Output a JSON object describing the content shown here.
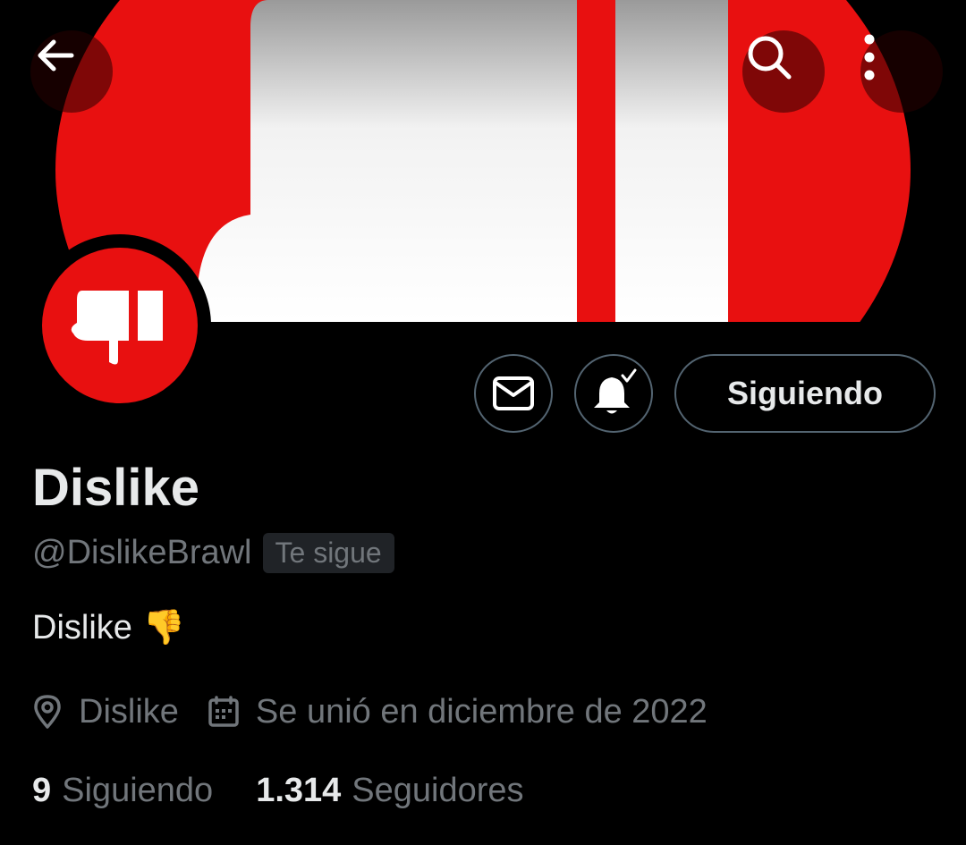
{
  "profile": {
    "name": "Dislike",
    "handle": "@DislikeBrawl",
    "follows_you_badge": "Te sigue",
    "bio_text": "Dislike",
    "bio_emoji": "👎",
    "location": "Dislike",
    "joined": "Se unió en diciembre de 2022"
  },
  "actions": {
    "follow_label": "Siguiendo"
  },
  "stats": {
    "following_count": "9",
    "following_label": "Siguiendo",
    "followers_count": "1.314",
    "followers_label": "Seguidores"
  },
  "icons": {
    "back": "arrow-left-icon",
    "search": "search-icon",
    "more": "more-vertical-icon",
    "message": "mail-icon",
    "notifications": "bell-check-icon",
    "location": "location-pin-icon",
    "calendar": "calendar-icon"
  },
  "colors": {
    "brand_red": "#e81010",
    "text_primary": "#e7e9ea",
    "text_secondary": "#71767b",
    "border": "#536471",
    "background": "#000000"
  }
}
